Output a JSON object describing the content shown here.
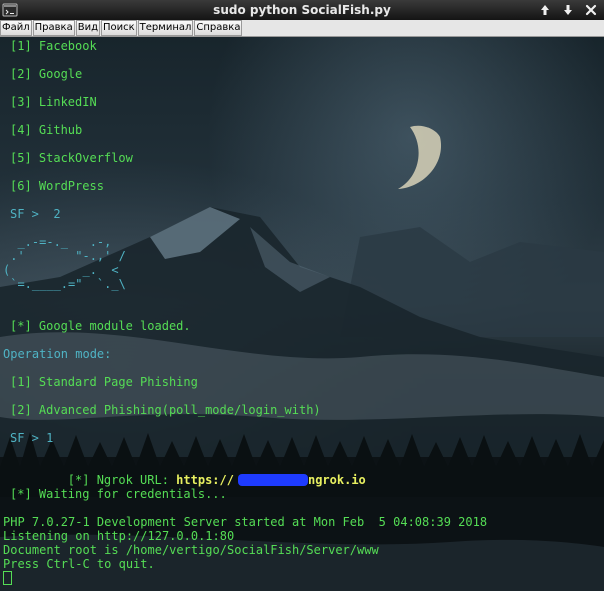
{
  "window": {
    "title": "sudo python SocialFish.py"
  },
  "menu": {
    "items": [
      "Файл",
      "Правка",
      "Вид",
      "Поиск",
      "Терминал",
      "Справка"
    ]
  },
  "terminal": {
    "sites": [
      "[1] Facebook",
      "[2] Google",
      "[3] LinkedIN",
      "[4] Github",
      "[5] StackOverflow",
      "[6] WordPress"
    ],
    "prompt1": "SF >  2",
    "art": [
      "  _.-=-._   .-,",
      " .'       \"-.,' /",
      "(          _.  <",
      " `=.____.=\"  `._\\"
    ],
    "loaded": "[*] Google module loaded.",
    "mode_label": "Operation mode:",
    "modes": [
      "[1] Standard Page Phishing",
      "[2] Advanced Phishing(poll_mode/login_with)"
    ],
    "prompt2": "SF > 1",
    "ngrok_label": "[*] Ngrok URL: ",
    "ngrok_url_start": "https://",
    "ngrok_url_end": "ngrok.io",
    "waiting": "[*] Waiting for credentials...",
    "server": [
      "PHP 7.0.27-1 Development Server started at Mon Feb  5 04:08:39 2018",
      "Listening on http://127.0.0.1:80",
      "Document root is /home/vertigo/SocialFish/Server/www",
      "Press Ctrl-C to quit."
    ]
  }
}
